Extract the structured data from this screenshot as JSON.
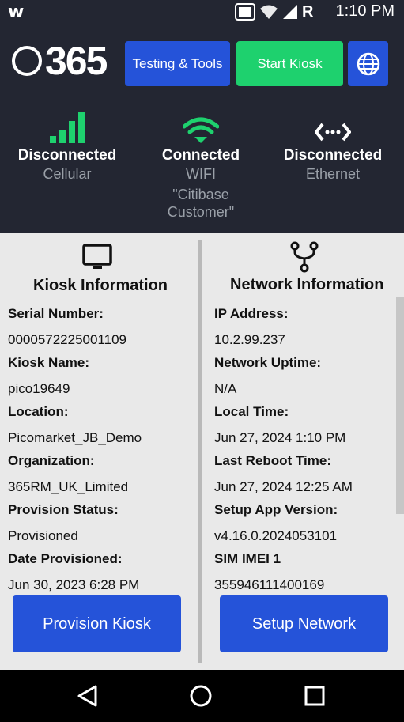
{
  "status_bar": {
    "app_icon_label": "w",
    "carrier_label": "R",
    "time": "1:10 PM",
    "icons": [
      "display-icon",
      "wifi-icon",
      "cell-signal-icon"
    ]
  },
  "header": {
    "logo_text": "365",
    "testing_tools_label": "Testing & Tools",
    "start_kiosk_label": "Start Kiosk",
    "language_icon": "globe-icon",
    "colors": {
      "background": "#232632",
      "blue": "#2553d9",
      "green": "#1ed16e"
    }
  },
  "connections": [
    {
      "status": "Disconnected",
      "type": "Cellular",
      "icon": "cell-signal-icon",
      "color": "#1ed16e"
    },
    {
      "status": "Connected",
      "type": "WIFI",
      "ssid": "\"Citibase Customer\"",
      "icon": "wifi-icon",
      "color": "#1ed16e"
    },
    {
      "status": "Disconnected",
      "type": "Ethernet",
      "icon": "ethernet-icon",
      "color": "#ffffff"
    }
  ],
  "kiosk": {
    "title": "Kiosk Information",
    "icon": "monitor-icon",
    "fields": [
      {
        "label": "Serial Number:",
        "value": "0000572225001109"
      },
      {
        "label": "Kiosk Name:",
        "value": "pico19649"
      },
      {
        "label": "Location:",
        "value": "Picomarket_JB_Demo"
      },
      {
        "label": "Organization:",
        "value": "365RM_UK_Limited"
      },
      {
        "label": "Provision Status:",
        "value": "Provisioned"
      },
      {
        "label": "Date Provisioned:",
        "value": "Jun 30, 2023 6:28 PM"
      }
    ],
    "action_label": "Provision Kiosk"
  },
  "network": {
    "title": "Network Information",
    "icon": "network-fork-icon",
    "fields": [
      {
        "label": "IP Address:",
        "value": "10.2.99.237"
      },
      {
        "label": "Network Uptime:",
        "value": "N/A"
      },
      {
        "label": "Local Time:",
        "value": "Jun 27, 2024 1:10 PM"
      },
      {
        "label": "Last Reboot Time:",
        "value": "Jun 27, 2024 12:25 AM"
      },
      {
        "label": "Setup App Version:",
        "value": "v4.16.0.2024053101"
      },
      {
        "label": "SIM IMEI 1",
        "value": "355946111400169"
      }
    ],
    "action_label": "Setup Network"
  },
  "nav_bar": {
    "buttons": [
      "back-icon",
      "home-icon",
      "recents-icon"
    ]
  }
}
